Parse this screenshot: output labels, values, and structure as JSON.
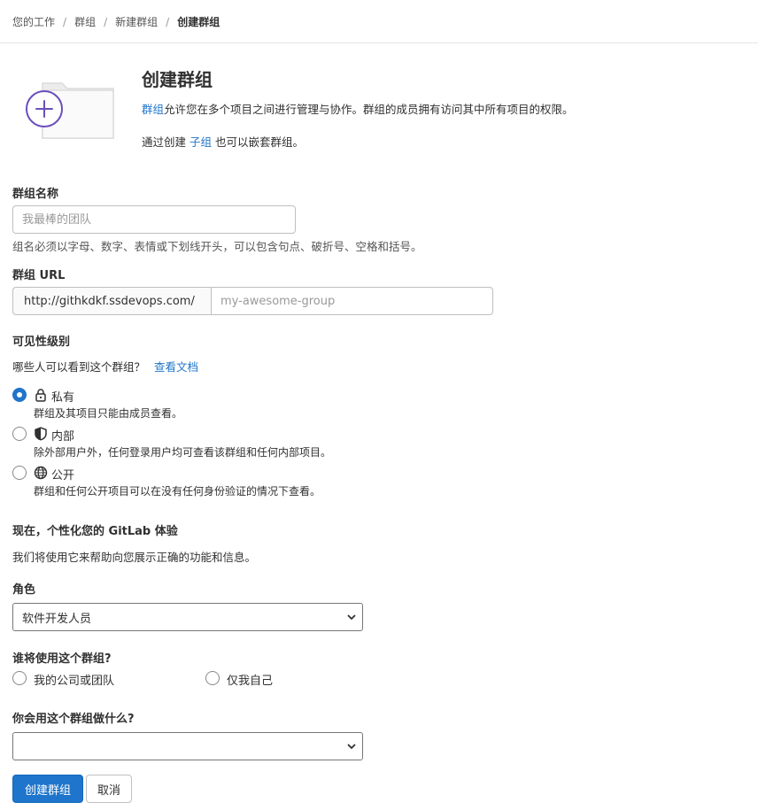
{
  "breadcrumb": [
    "您的工作",
    "群组",
    "新建群组",
    "创建群组"
  ],
  "header": {
    "title": "创建群组",
    "desc_link": "群组",
    "desc_text": "允许您在多个项目之间进行管理与协作。群组的成员拥有访问其中所有项目的权限。",
    "nest_prefix": "通过创建",
    "nest_link": "子组",
    "nest_suffix": "也可以嵌套群组。"
  },
  "group_name": {
    "label": "群组名称",
    "placeholder": "我最棒的团队",
    "help": "组名必须以字母、数字、表情或下划线开头，可以包含句点、破折号、空格和括号。"
  },
  "group_url": {
    "label": "群组 URL",
    "prefix": "http://githkdkf.ssdevops.com/",
    "placeholder": "my-awesome-group"
  },
  "visibility": {
    "label": "可见性级别",
    "question": "哪些人可以看到这个群组？",
    "doc_link": "查看文档",
    "options": [
      {
        "label": "私有",
        "desc": "群组及其项目只能由成员查看。",
        "icon": "lock-icon",
        "checked": true
      },
      {
        "label": "内部",
        "desc": "除外部用户外，任何登录用户均可查看该群组和任何内部项目。",
        "icon": "shield-icon",
        "checked": false
      },
      {
        "label": "公开",
        "desc": "群组和任何公开项目可以在没有任何身份验证的情况下查看。",
        "icon": "globe-icon",
        "checked": false
      }
    ]
  },
  "personalize": {
    "title": "现在，个性化您的 GitLab 体验",
    "desc": "我们将使用它来帮助向您展示正确的功能和信息。"
  },
  "role": {
    "label": "角色",
    "selected": "软件开发人员"
  },
  "who_uses": {
    "label": "谁将使用这个群组?",
    "options": [
      "我的公司或团队",
      "仅我自己"
    ]
  },
  "purpose": {
    "label": "你会用这个群组做什么?",
    "selected": ""
  },
  "buttons": {
    "create": "创建群组",
    "cancel": "取消"
  },
  "colors": {
    "primary": "#1f75cb",
    "illustration_purple": "#6b4fbb"
  }
}
